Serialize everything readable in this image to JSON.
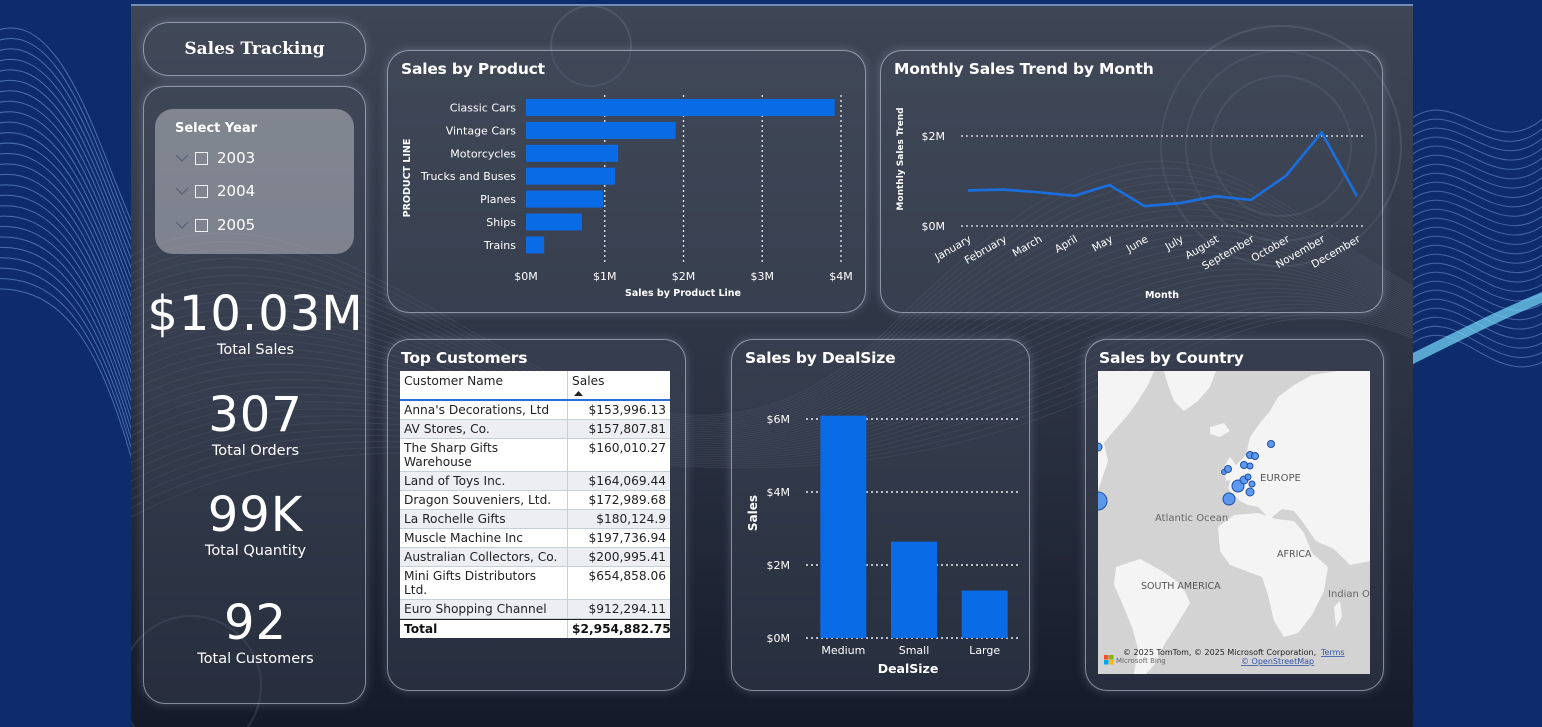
{
  "report_title": "Sales Tracking",
  "slicer": {
    "header": "Select Year",
    "items": [
      {
        "label": "2003"
      },
      {
        "label": "2004"
      },
      {
        "label": "2005"
      }
    ]
  },
  "kpis": {
    "total_sales": {
      "value": "$10.03M",
      "label": "Total Sales"
    },
    "total_orders": {
      "value": "307",
      "label": "Total Orders"
    },
    "total_quantity": {
      "value": "99K",
      "label": "Total Quantity"
    },
    "total_customers": {
      "value": "92",
      "label": "Total Customers"
    }
  },
  "sales_by_product": {
    "title": "Sales by Product",
    "chart_data": {
      "type": "bar",
      "orientation": "horizontal",
      "categories": [
        "Classic Cars",
        "Vintage Cars",
        "Motorcycles",
        "Trucks and Buses",
        "Planes",
        "Ships",
        "Trains"
      ],
      "values": [
        3.92,
        1.9,
        1.17,
        1.13,
        0.98,
        0.71,
        0.23
      ],
      "value_unit": "M",
      "xlabel": "Sales by Product Line",
      "ylabel": "PRODUCT LINE",
      "xlim": [
        0,
        4
      ],
      "x_ticks": [
        "$0M",
        "$1M",
        "$2M",
        "$3M",
        "$4M"
      ],
      "grid": true,
      "bar_color": "#0a6be6"
    }
  },
  "monthly_trend": {
    "title": "Monthly Sales Trend by Month",
    "chart_data": {
      "type": "line",
      "categories": [
        "January",
        "February",
        "March",
        "April",
        "May",
        "June",
        "July",
        "August",
        "September",
        "October",
        "November",
        "December"
      ],
      "values": [
        0.79,
        0.81,
        0.75,
        0.67,
        0.91,
        0.44,
        0.51,
        0.66,
        0.58,
        1.12,
        2.08,
        0.66
      ],
      "value_unit": "M",
      "xlabel": "Month",
      "ylabel": "Monthly Sales Trend",
      "ylim": [
        0,
        2
      ],
      "y_ticks": [
        "$0M",
        "$2M"
      ],
      "grid": true,
      "line_color": "#1a6fe0"
    }
  },
  "top_customers": {
    "title": "Top Customers",
    "columns": [
      "Customer Name",
      "Sales"
    ],
    "rows": [
      [
        "Anna's Decorations, Ltd",
        "$153,996.13"
      ],
      [
        "AV Stores, Co.",
        "$157,807.81"
      ],
      [
        "The Sharp Gifts Warehouse",
        "$160,010.27"
      ],
      [
        "Land of Toys Inc.",
        "$164,069.44"
      ],
      [
        "Dragon Souveniers, Ltd.",
        "$172,989.68"
      ],
      [
        "La Rochelle Gifts",
        "$180,124.9"
      ],
      [
        "Muscle Machine Inc",
        "$197,736.94"
      ],
      [
        "Australian Collectors, Co.",
        "$200,995.41"
      ],
      [
        "Mini Gifts Distributors Ltd.",
        "$654,858.06"
      ],
      [
        "Euro Shopping Channel",
        "$912,294.11"
      ]
    ],
    "total_label": "Total",
    "total_value": "$2,954,882.75"
  },
  "deal_size": {
    "title": "Sales by DealSize",
    "chart_data": {
      "type": "bar",
      "categories": [
        "Medium",
        "Small",
        "Large"
      ],
      "values": [
        6.09,
        2.64,
        1.3
      ],
      "value_unit": "M",
      "xlabel": "DealSize",
      "ylabel": "Sales",
      "ylim": [
        0,
        6
      ],
      "y_ticks": [
        "$0M",
        "$2M",
        "$4M",
        "$6M"
      ],
      "grid": true,
      "bar_color": "#0a6be6"
    }
  },
  "country_map": {
    "title": "Sales by Country",
    "labels": {
      "europe": "EUROPE",
      "atlantic": "Atlantic Ocean",
      "africa": "AFRICA",
      "south_america": "SOUTH AMERICA",
      "indian": "Indian Oc"
    },
    "attribution": "© 2025 TomTom, © 2025 Microsoft Corporation,",
    "terms": "Terms",
    "osm": "© OpenStreetMap",
    "bing": "Microsoft Bing"
  }
}
